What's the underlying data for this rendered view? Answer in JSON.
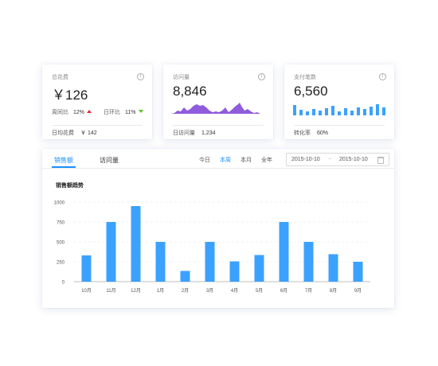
{
  "cards": [
    {
      "label": "总花费",
      "value": "￥126",
      "trend": {
        "wow_label": "周同比",
        "wow_value": "12%",
        "wow_dir": "up",
        "dod_label": "日环比",
        "dod_value": "11%",
        "dod_dir": "down"
      },
      "footer_label": "日均花费",
      "footer_value": "￥ 142"
    },
    {
      "label": "访问量",
      "value": "8,846",
      "footer_label": "日访问量",
      "footer_value": "1,234",
      "sparkline_color": "#8e5cdc"
    },
    {
      "label": "支付笔数",
      "value": "6,560",
      "footer_label": "转化率",
      "footer_value": "60%",
      "minibar_color": "#3ba1ff"
    }
  ],
  "info_glyph": "i",
  "tabs": [
    "销售额",
    "访问量"
  ],
  "ranges": [
    "今日",
    "本周",
    "本月",
    "全年"
  ],
  "active_range": "本周",
  "date_range": {
    "start": "2015-10-10",
    "separator": "~",
    "end": "2015-10-10"
  },
  "colors": {
    "accent": "#1890ff",
    "bar": "#3ba1ff",
    "up": "#f5222d",
    "down": "#52c41a"
  },
  "chart_data": {
    "type": "bar",
    "title": "销售额趋势",
    "categories": [
      "10月",
      "11月",
      "12月",
      "1月",
      "2月",
      "3月",
      "4月",
      "5月",
      "6月",
      "7月",
      "8月",
      "9月"
    ],
    "values": [
      330,
      750,
      950,
      500,
      135,
      500,
      255,
      335,
      750,
      500,
      345,
      250
    ],
    "ylim": [
      0,
      1000
    ],
    "yticks": [
      0,
      250,
      500,
      750,
      1000
    ],
    "grid": true,
    "color": "#3ba1ff"
  }
}
